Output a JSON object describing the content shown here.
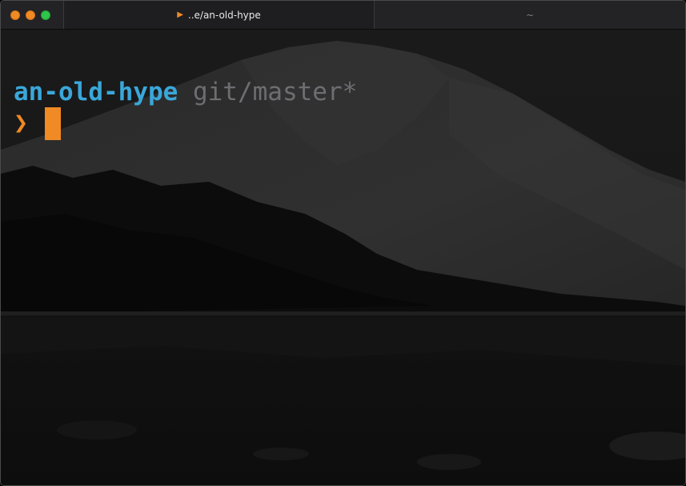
{
  "window": {
    "traffic_lights": [
      "close",
      "minimize",
      "zoom"
    ]
  },
  "tabs": [
    {
      "label": "..e/an-old-hype",
      "active": true,
      "indicator_icon": "play-arrow-icon"
    },
    {
      "label": "~",
      "active": false
    }
  ],
  "prompt": {
    "directory": "an-old-hype",
    "git_status": "git/master*",
    "symbol": "❯",
    "cursor": "block"
  },
  "colors": {
    "accent": "#f08a24",
    "directory": "#3aa7d9",
    "git": "#6e6e72",
    "zoom": "#2fc44a"
  }
}
